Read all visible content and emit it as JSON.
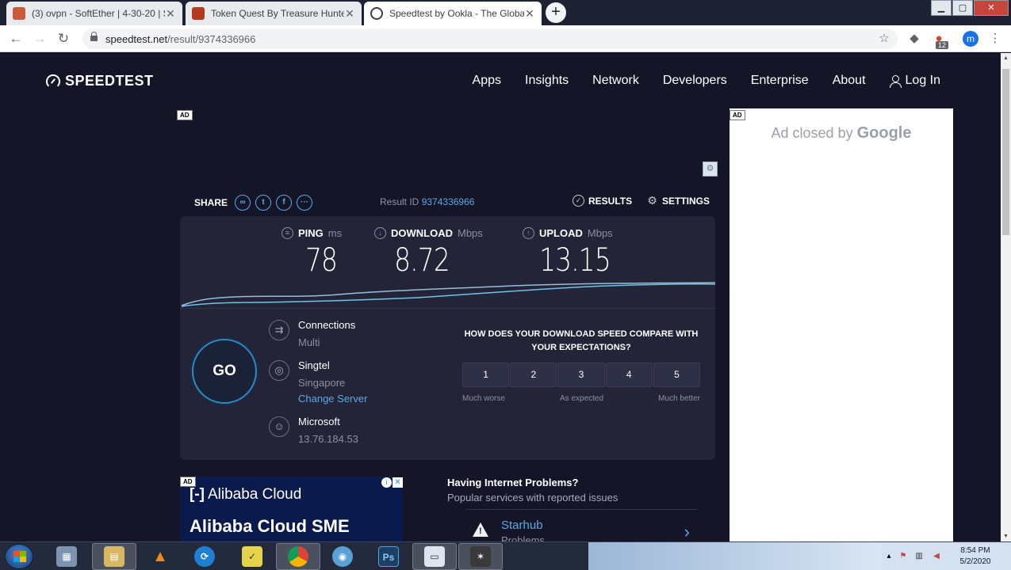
{
  "browser": {
    "tabs": [
      {
        "title": "(3) ovpn - SoftEther | 4-30-20 | Su",
        "active": false
      },
      {
        "title": "Token Quest By Treasure Hunter",
        "active": false
      },
      {
        "title": "Speedtest by Ookla - The Global",
        "active": true
      }
    ],
    "new_tab_label": "+",
    "url_host": "speedtest.net",
    "url_path": "/result/9374336966",
    "extension_badge": "12",
    "profile_initial": "m",
    "window_buttons": {
      "minimize": "▁",
      "maximize": "▢",
      "close": "✕"
    }
  },
  "site": {
    "logo": "SPEEDTEST",
    "nav": [
      "Apps",
      "Insights",
      "Network",
      "Developers",
      "Enterprise",
      "About"
    ],
    "login": "Log In"
  },
  "ad_tag": "AD",
  "share": {
    "label": "SHARE",
    "result_id_label": "Result ID",
    "result_id": "9374336966",
    "results_label": "RESULTS",
    "settings_label": "SETTINGS"
  },
  "metrics": {
    "ping": {
      "label": "PING",
      "unit": "ms",
      "value": "78"
    },
    "download": {
      "label": "DOWNLOAD",
      "unit": "Mbps",
      "value": "8.72"
    },
    "upload": {
      "label": "UPLOAD",
      "unit": "Mbps",
      "value": "13.15"
    }
  },
  "go_label": "GO",
  "server": {
    "connections_label": "Connections",
    "connections_value": "Multi",
    "isp": "Singtel",
    "location": "Singapore",
    "change_server": "Change Server",
    "host": "Microsoft",
    "ip": "13.76.184.53"
  },
  "survey": {
    "question": "HOW DOES YOUR DOWNLOAD SPEED COMPARE WITH YOUR EXPECTATIONS?",
    "options": [
      "1",
      "2",
      "3",
      "4",
      "5"
    ],
    "low_label": "Much worse",
    "mid_label": "As expected",
    "high_label": "Much better"
  },
  "ad_right": {
    "text": "Ad closed by",
    "brand": "Google"
  },
  "ad_bottom": {
    "brand": "Alibaba Cloud",
    "headline": "Alibaba Cloud SME"
  },
  "problems": {
    "title": "Having Internet Problems?",
    "subtitle": "Popular services with reported issues",
    "isp_name": "Starhub",
    "isp_status": "Problems"
  },
  "taskbar": {
    "time": "8:54 PM",
    "date": "5/2/2020"
  },
  "colors": {
    "page_bg": "#141526",
    "panel_bg": "#232437",
    "accent": "#5ba9e4"
  }
}
